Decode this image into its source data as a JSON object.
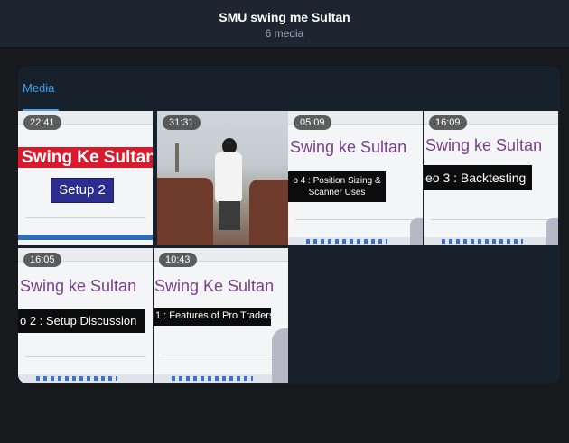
{
  "header": {
    "title": "SMU swing me Sultan",
    "subtitle": "6 media"
  },
  "tabs": [
    {
      "label": "Media",
      "active": true
    }
  ],
  "accent_color": "#3aa0ea",
  "media": [
    {
      "duration": "22:41",
      "heading": "Swing Ke Sultan",
      "caption": "Setup 2"
    },
    {
      "duration": "31:31"
    },
    {
      "duration": "05:09",
      "heading": "Swing ke Sultan",
      "caption": "o 4 : Position Sizing & Scanner Uses"
    },
    {
      "duration": "16:09",
      "heading": "Swing ke Sultan",
      "caption": "eo 3 : Backtesting"
    },
    {
      "duration": "16:05",
      "heading": "Swing ke Sultan",
      "caption": "o 2 : Setup Discussion"
    },
    {
      "duration": "10:43",
      "heading": "Swing Ke Sultan",
      "caption": "1 : Features of Pro Traders"
    }
  ]
}
